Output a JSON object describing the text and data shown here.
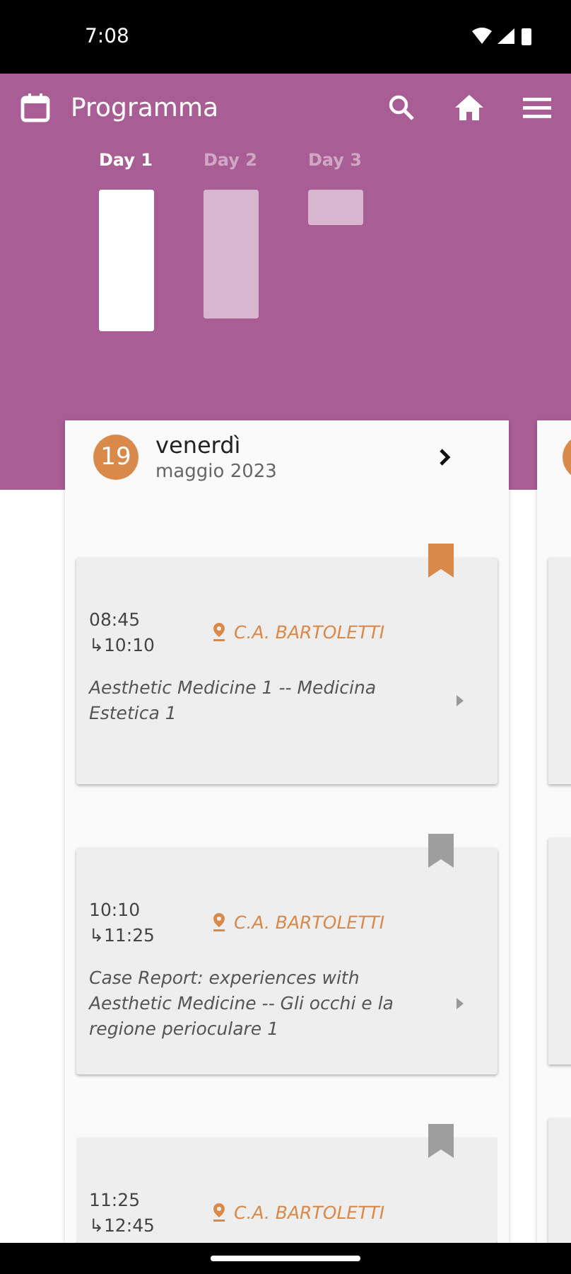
{
  "status_bar": {
    "time": "7:08"
  },
  "app_bar": {
    "title": "Programma"
  },
  "days": [
    {
      "label": "Day 1",
      "selected": true
    },
    {
      "label": "Day 2",
      "selected": false
    },
    {
      "label": "Day 3",
      "selected": false
    }
  ],
  "day_card": {
    "day_number": "19",
    "weekday": "venerdì",
    "month": "maggio 2023"
  },
  "sessions": [
    {
      "start": "08:45",
      "end": "↳10:10",
      "location": "C.A. BARTOLETTI",
      "title": "Aesthetic Medicine 1 -- Medicina Estetica 1",
      "bookmarked": true
    },
    {
      "start": "10:10",
      "end": "↳11:25",
      "location": "C.A. BARTOLETTI",
      "title": "Case Report: experiences with Aesthetic Medicine -- Gli occhi e la regione perioculare 1",
      "bookmarked": false
    },
    {
      "start": "11:25",
      "end": "↳12:45",
      "location": "C.A. BARTOLETTI",
      "bookmarked": false
    }
  ]
}
